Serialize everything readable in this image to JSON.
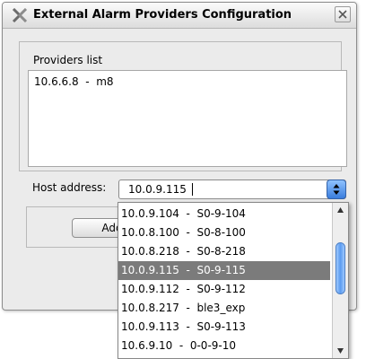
{
  "dialog": {
    "title": "External Alarm Providers Configuration"
  },
  "providers": {
    "legend": "Providers list",
    "items": [
      "10.6.6.8  -  m8"
    ]
  },
  "host": {
    "label": "Host address:",
    "value": "10.0.9.115"
  },
  "buttons": {
    "add_label": "Add"
  },
  "dropdown": {
    "options": [
      "10.0.9.104  -  S0-9-104",
      "10.0.8.100  -  S0-8-100",
      "10.0.8.218  -  S0-8-218",
      "10.0.9.115  -  S0-9-115",
      "10.0.9.112  -  S0-9-112",
      "10.0.8.217  -  ble3_exp",
      "10.0.9.113  -  S0-9-113",
      "10.6.9.10  -  0-0-9-10"
    ],
    "selected_index": 3
  },
  "colors": {
    "selection_bg": "#7b7b7b",
    "spin_button": "#3a7ddd"
  }
}
